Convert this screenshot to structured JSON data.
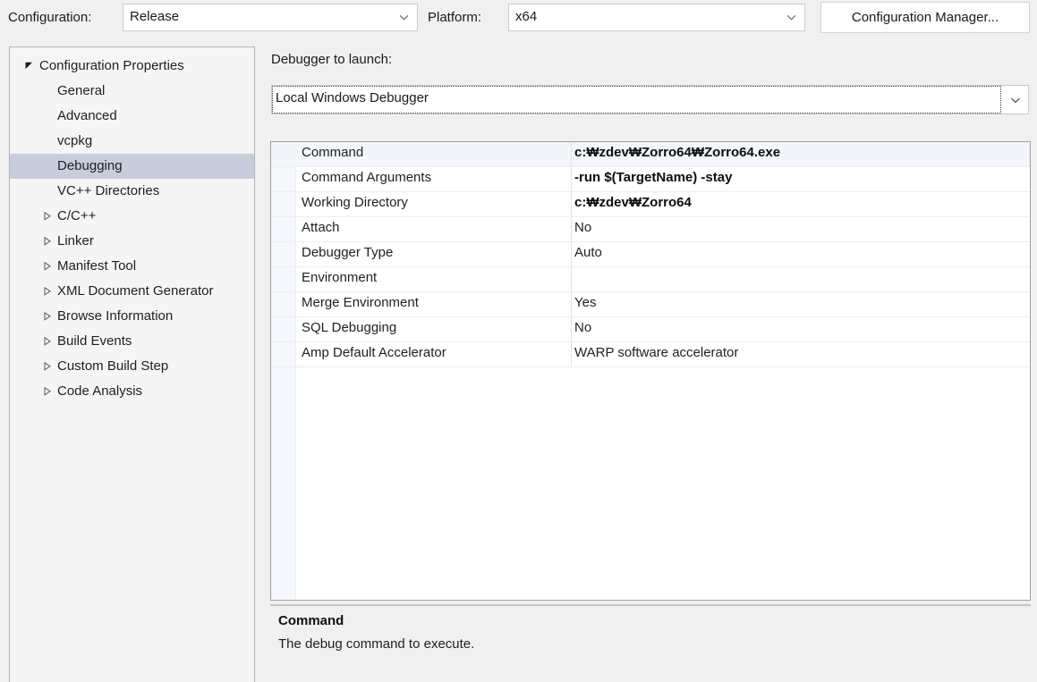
{
  "toolbar": {
    "configuration_label": "Configuration:",
    "configuration_value": "Release",
    "platform_label": "Platform:",
    "platform_value": "x64",
    "configuration_manager_button": "Configuration Manager..."
  },
  "sidebar": {
    "items": [
      {
        "label": "Configuration Properties",
        "depth": 0,
        "expander": "expanded",
        "selected": false
      },
      {
        "label": "General",
        "depth": 1,
        "expander": "none",
        "selected": false
      },
      {
        "label": "Advanced",
        "depth": 1,
        "expander": "none",
        "selected": false
      },
      {
        "label": "vcpkg",
        "depth": 1,
        "expander": "none",
        "selected": false
      },
      {
        "label": "Debugging",
        "depth": 1,
        "expander": "none",
        "selected": true
      },
      {
        "label": "VC++ Directories",
        "depth": 1,
        "expander": "none",
        "selected": false
      },
      {
        "label": "C/C++",
        "depth": 1,
        "expander": "collapsed",
        "selected": false
      },
      {
        "label": "Linker",
        "depth": 1,
        "expander": "collapsed",
        "selected": false
      },
      {
        "label": "Manifest Tool",
        "depth": 1,
        "expander": "collapsed",
        "selected": false
      },
      {
        "label": "XML Document Generator",
        "depth": 1,
        "expander": "collapsed",
        "selected": false
      },
      {
        "label": "Browse Information",
        "depth": 1,
        "expander": "collapsed",
        "selected": false
      },
      {
        "label": "Build Events",
        "depth": 1,
        "expander": "collapsed",
        "selected": false
      },
      {
        "label": "Custom Build Step",
        "depth": 1,
        "expander": "collapsed",
        "selected": false
      },
      {
        "label": "Code Analysis",
        "depth": 1,
        "expander": "collapsed",
        "selected": false
      }
    ]
  },
  "main": {
    "debugger_label": "Debugger to launch:",
    "debugger_value": "Local Windows Debugger",
    "properties": [
      {
        "name": "Command",
        "value": "c:₩zdev₩Zorro64₩Zorro64.exe",
        "bold": true,
        "selected": true
      },
      {
        "name": "Command Arguments",
        "value": "-run $(TargetName) -stay",
        "bold": true,
        "selected": false
      },
      {
        "name": "Working Directory",
        "value": "c:₩zdev₩Zorro64",
        "bold": true,
        "selected": false
      },
      {
        "name": "Attach",
        "value": "No",
        "bold": false,
        "selected": false
      },
      {
        "name": "Debugger Type",
        "value": "Auto",
        "bold": false,
        "selected": false
      },
      {
        "name": "Environment",
        "value": "",
        "bold": false,
        "selected": false
      },
      {
        "name": "Merge Environment",
        "value": "Yes",
        "bold": false,
        "selected": false
      },
      {
        "name": "SQL Debugging",
        "value": "No",
        "bold": false,
        "selected": false
      },
      {
        "name": "Amp Default Accelerator",
        "value": "WARP software accelerator",
        "bold": false,
        "selected": false
      }
    ]
  },
  "description": {
    "title": "Command",
    "text": "The debug command to execute."
  }
}
